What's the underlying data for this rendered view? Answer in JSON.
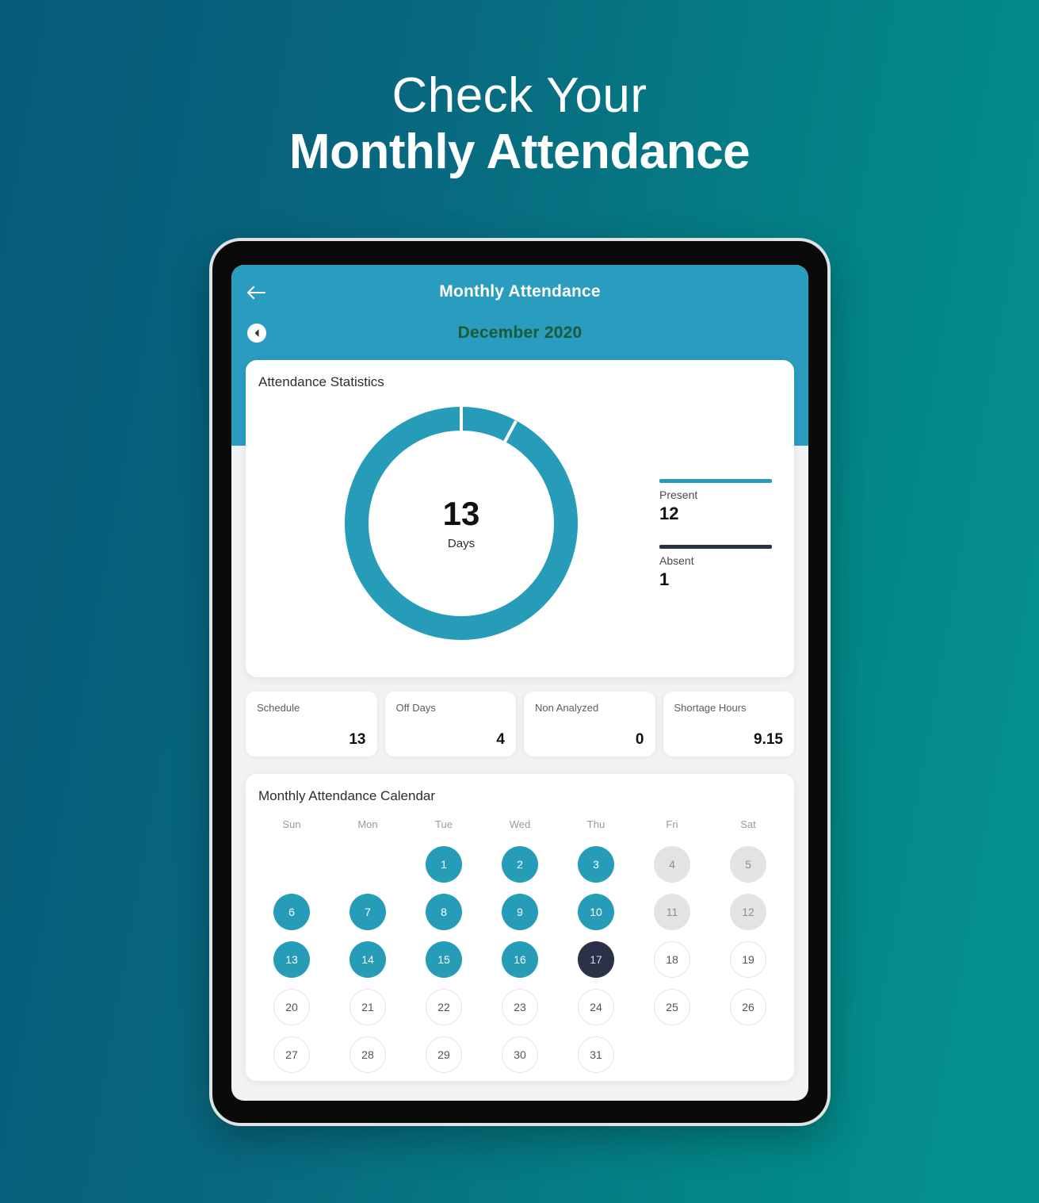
{
  "hero": {
    "line1": "Check Your",
    "line2": "Monthly Attendance"
  },
  "app": {
    "header": {
      "back_icon": "arrow-left-icon",
      "title": "Monthly Attendance",
      "prev_month_icon": "chevron-left-icon",
      "month_label": "December 2020",
      "bg_color": "#2a9cbf",
      "month_text_color": "#1a5b3a"
    },
    "stats": {
      "title": "Attendance Statistics",
      "center_value": "13",
      "center_unit": "Days",
      "legend": [
        {
          "label": "Present",
          "value": "12",
          "color": "#279cb8"
        },
        {
          "label": "Absent",
          "value": "1",
          "color": "#2b3147"
        }
      ]
    },
    "metrics": [
      {
        "label": "Schedule",
        "value": "13"
      },
      {
        "label": "Off Days",
        "value": "4"
      },
      {
        "label": "Non Analyzed",
        "value": "0"
      },
      {
        "label": "Shortage Hours",
        "value": "9.15"
      }
    ],
    "calendar": {
      "title": "Monthly Attendance Calendar",
      "weekdays": [
        "Sun",
        "Mon",
        "Tue",
        "Wed",
        "Thu",
        "Fri",
        "Sat"
      ],
      "days": [
        {
          "label": "",
          "state": "empty"
        },
        {
          "label": "",
          "state": "empty"
        },
        {
          "label": "1",
          "state": "present"
        },
        {
          "label": "2",
          "state": "present"
        },
        {
          "label": "3",
          "state": "present"
        },
        {
          "label": "4",
          "state": "off"
        },
        {
          "label": "5",
          "state": "off"
        },
        {
          "label": "6",
          "state": "present"
        },
        {
          "label": "7",
          "state": "present"
        },
        {
          "label": "8",
          "state": "present"
        },
        {
          "label": "9",
          "state": "present"
        },
        {
          "label": "10",
          "state": "present"
        },
        {
          "label": "11",
          "state": "off"
        },
        {
          "label": "12",
          "state": "off"
        },
        {
          "label": "13",
          "state": "present"
        },
        {
          "label": "14",
          "state": "present"
        },
        {
          "label": "15",
          "state": "present"
        },
        {
          "label": "16",
          "state": "present"
        },
        {
          "label": "17",
          "state": "absent"
        },
        {
          "label": "18",
          "state": "plain"
        },
        {
          "label": "19",
          "state": "plain"
        },
        {
          "label": "20",
          "state": "plain"
        },
        {
          "label": "21",
          "state": "plain"
        },
        {
          "label": "22",
          "state": "plain"
        },
        {
          "label": "23",
          "state": "plain"
        },
        {
          "label": "24",
          "state": "plain"
        },
        {
          "label": "25",
          "state": "plain"
        },
        {
          "label": "26",
          "state": "plain"
        },
        {
          "label": "27",
          "state": "plain"
        },
        {
          "label": "28",
          "state": "plain"
        },
        {
          "label": "29",
          "state": "plain"
        },
        {
          "label": "30",
          "state": "plain"
        },
        {
          "label": "31",
          "state": "plain"
        },
        {
          "label": "",
          "state": "empty"
        },
        {
          "label": "",
          "state": "empty"
        }
      ]
    }
  },
  "chart_data": {
    "type": "pie",
    "title": "Attendance Statistics",
    "labels": [
      "Present",
      "Absent",
      "Off Days"
    ],
    "values": [
      12,
      1,
      4
    ],
    "colors": [
      "#279cb8",
      "#279cb8",
      "#279cb8"
    ],
    "center_label": "13",
    "center_sublabel": "Days",
    "legend_position": "right",
    "donut": true,
    "inner_radius_ratio": 0.78
  },
  "theme": {
    "bg_gradient_from": "#065a78",
    "bg_gradient_to": "#04928f",
    "accent": "#2a9cbf",
    "dark": "#2b3147"
  }
}
